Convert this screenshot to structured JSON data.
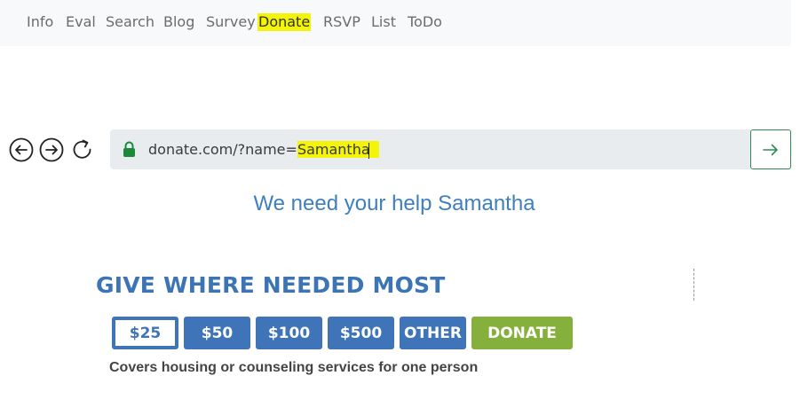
{
  "nav": {
    "items": [
      {
        "label": "Info"
      },
      {
        "label": "Eval"
      },
      {
        "label": "Search"
      },
      {
        "label": "Blog"
      },
      {
        "label": "Survey"
      },
      {
        "label": "Donate",
        "active": true
      },
      {
        "label": "RSVP"
      },
      {
        "label": "List"
      },
      {
        "label": "ToDo"
      }
    ]
  },
  "browser": {
    "back_icon": "arrow-left-circle-icon",
    "forward_icon": "arrow-right-circle-icon",
    "reload_icon": "reload-icon",
    "lock_icon": "lock-icon",
    "go_icon": "arrow-right-icon",
    "url_prefix": "donate.com/?name=",
    "url_value": "Samantha"
  },
  "page": {
    "headline": "We need your help Samantha",
    "give_title": "GIVE WHERE NEEDED MOST",
    "amounts": [
      "$25",
      "$50",
      "$100",
      "$500",
      "OTHER"
    ],
    "selected_amount": "$25",
    "donate_label": "DONATE",
    "description": "Covers housing or counseling services for one person"
  },
  "colors": {
    "nav_highlight": "#f4f40a",
    "headline_blue": "#3f7fbf",
    "button_blue": "#3f74b8",
    "donate_green": "#86b03c",
    "go_green": "#2e8b57"
  }
}
